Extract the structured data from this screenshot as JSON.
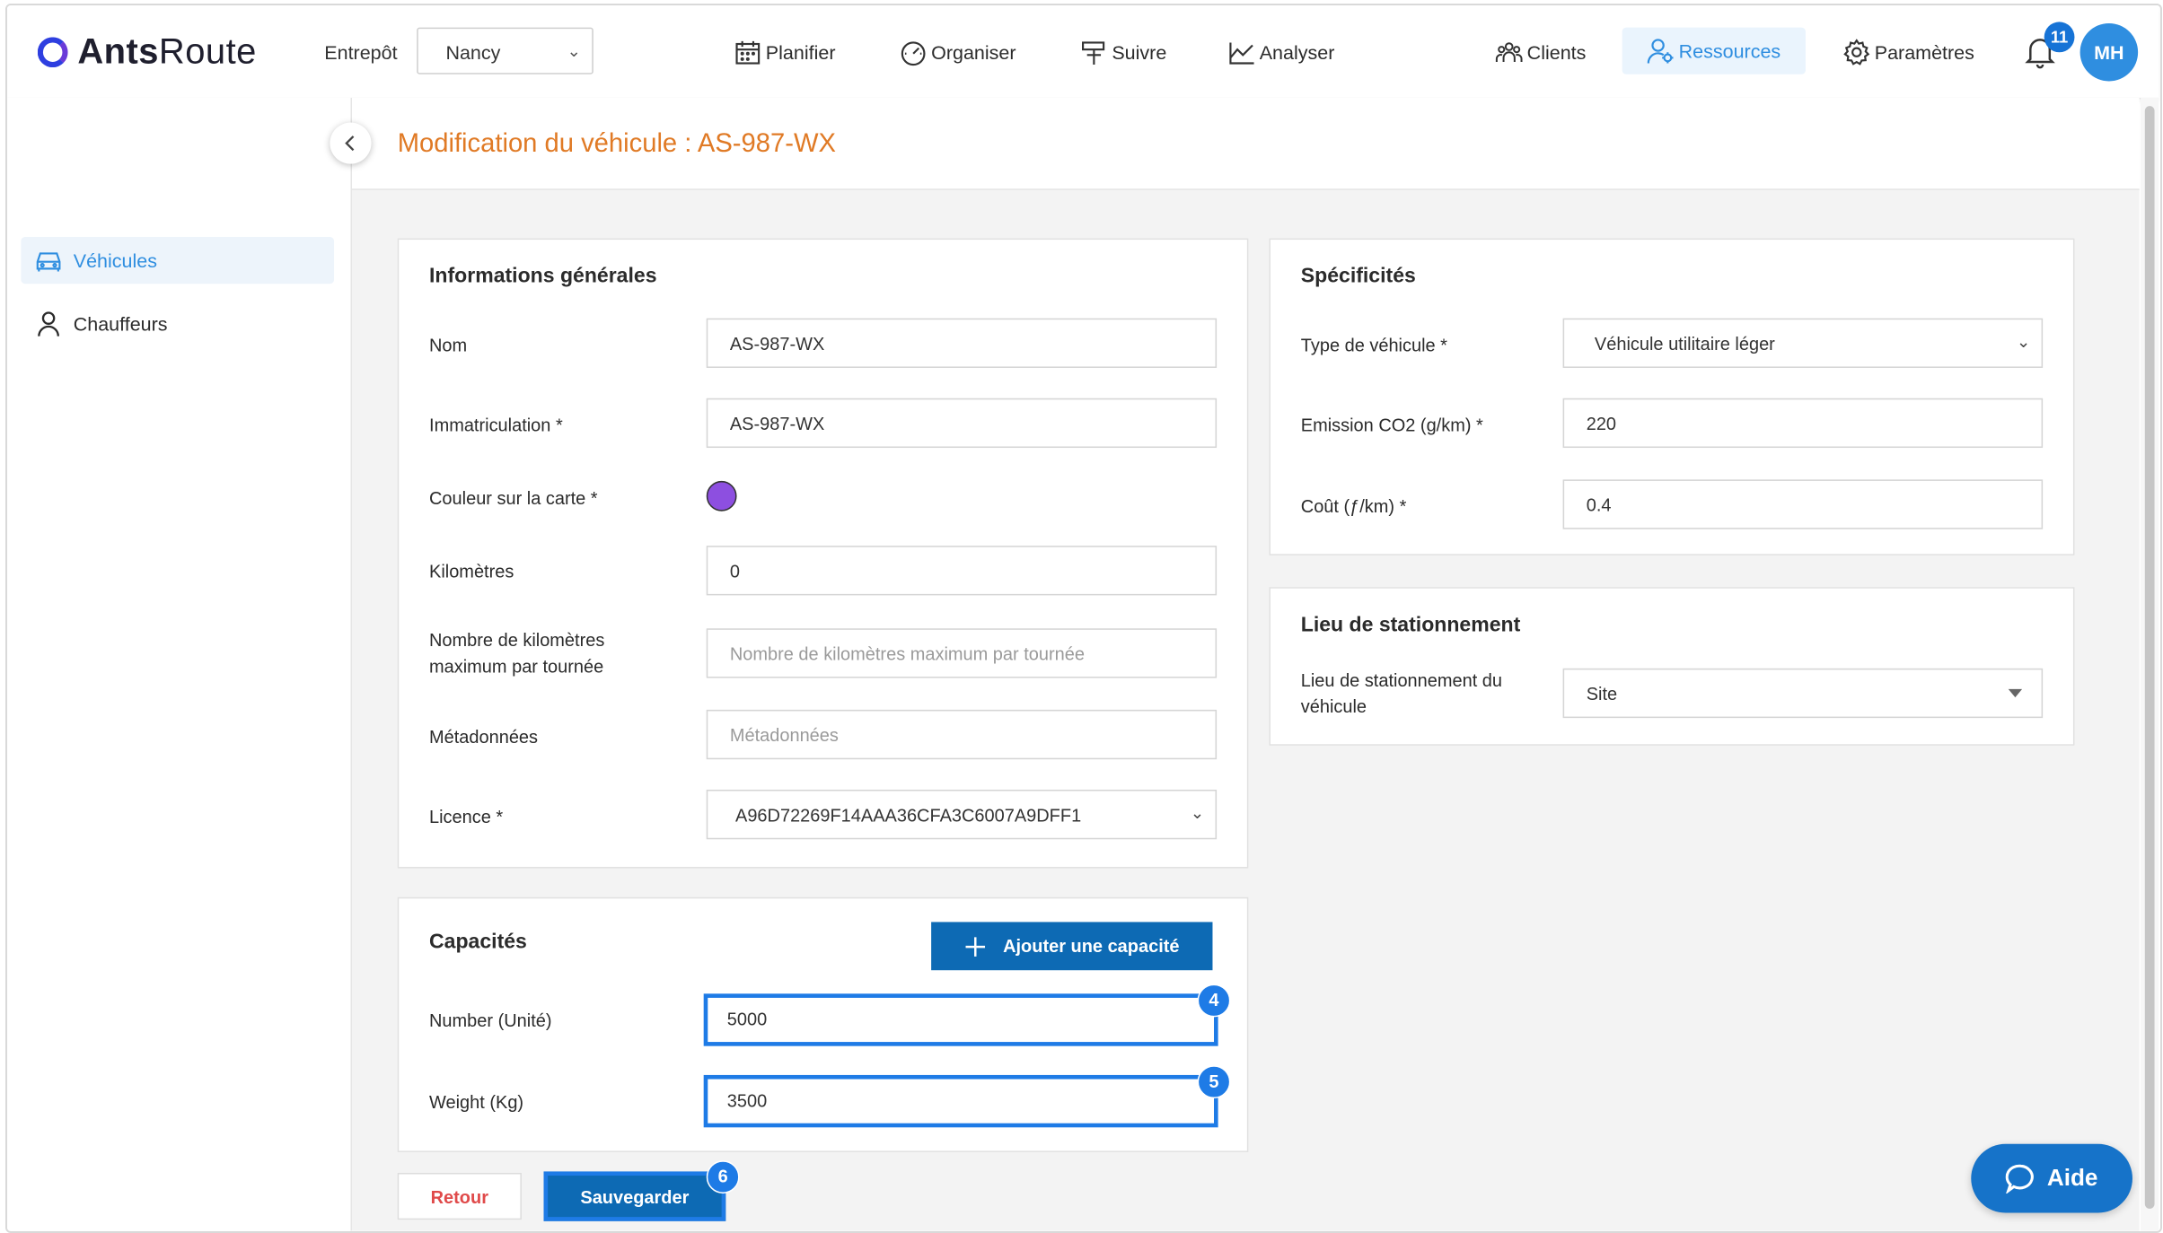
{
  "app": {
    "logo_bold": "Ants",
    "logo_light": "Route"
  },
  "header": {
    "warehouse_label": "Entrepôt",
    "warehouse_value": "Nancy",
    "nav": {
      "plan": "Planifier",
      "organize": "Organiser",
      "track": "Suivre",
      "analyze": "Analyser",
      "clients": "Clients",
      "resources": "Ressources",
      "settings": "Paramètres"
    },
    "notifications_count": "11",
    "user_initials": "MH"
  },
  "sidebar": {
    "items": [
      {
        "label": "Véhicules",
        "icon": "car-icon",
        "active": true
      },
      {
        "label": "Chauffeurs",
        "icon": "person-icon",
        "active": false
      }
    ]
  },
  "page": {
    "title": "Modification du véhicule : AS-987-WX"
  },
  "general": {
    "title": "Informations générales",
    "name_label": "Nom",
    "name_value": "AS-987-WX",
    "plate_label": "Immatriculation *",
    "plate_value": "AS-987-WX",
    "color_label": "Couleur sur la carte *",
    "color_value": "#8d4fe0",
    "km_label": "Kilomètres",
    "km_value": "0",
    "maxkm_label_1": "Nombre de kilomètres",
    "maxkm_label_2": "maximum par tournée",
    "maxkm_placeholder": "Nombre de kilomètres maximum par tournée",
    "meta_label": "Métadonnées",
    "meta_placeholder": "Métadonnées",
    "license_label": "Licence *",
    "license_value": "A96D72269F14AAA36CFA3C6007A9DFF1"
  },
  "specs": {
    "title": "Spécificités",
    "type_label": "Type de véhicule *",
    "type_value": "Véhicule utilitaire léger",
    "co2_label": "Emission CO2 (g/km) *",
    "co2_value": "220",
    "cost_label": "Coût (ƒ/km) *",
    "cost_value": "0.4"
  },
  "parking": {
    "title": "Lieu de stationnement",
    "label_1": "Lieu de stationnement du",
    "label_2": "véhicule",
    "value": "Site"
  },
  "capacities": {
    "title": "Capacités",
    "add_button": "Ajouter une capacité",
    "number_label": "Number (Unité)",
    "number_value": "5000",
    "number_marker": "4",
    "weight_label": "Weight (Kg)",
    "weight_value": "3500",
    "weight_marker": "5"
  },
  "actions": {
    "back": "Retour",
    "save": "Sauvegarder",
    "save_marker": "6"
  },
  "help": {
    "label": "Aide"
  },
  "colors": {
    "accent": "#2f8ee0",
    "title_orange": "#e07a25",
    "primary_button": "#0d6ab4",
    "highlight": "#1e7be6"
  }
}
